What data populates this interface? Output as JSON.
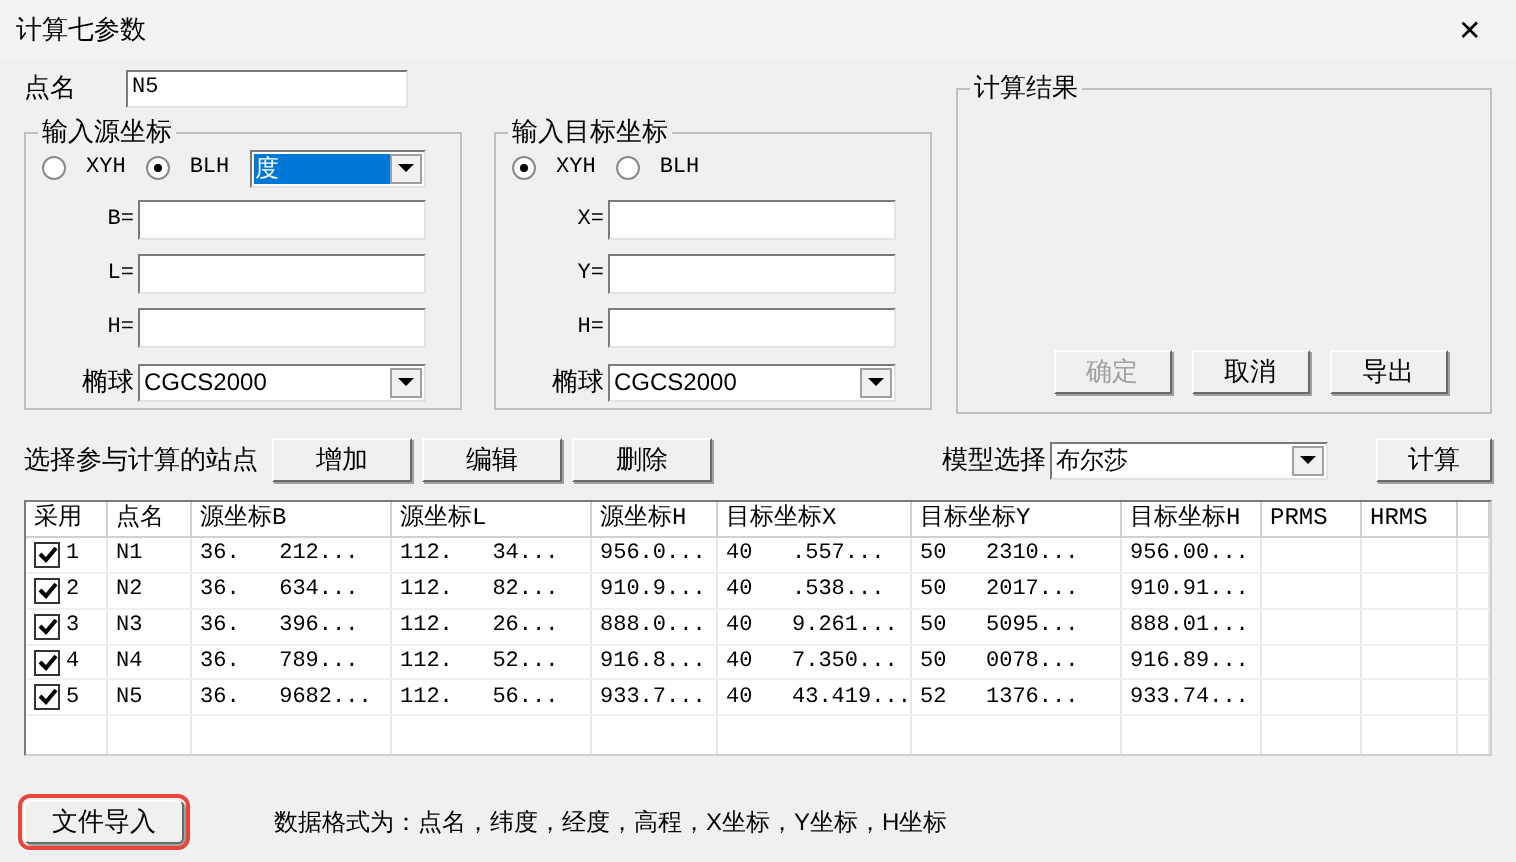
{
  "window": {
    "title": "计算七参数",
    "close": "✕"
  },
  "point_name": {
    "label": "点名",
    "value": "N5"
  },
  "source": {
    "title": "输入源坐标",
    "radios": [
      {
        "label": "XYH",
        "selected": false
      },
      {
        "label": "BLH",
        "selected": true
      }
    ],
    "unit": {
      "value": "度"
    },
    "fields": [
      {
        "label": "B="
      },
      {
        "label": "L="
      },
      {
        "label": "H="
      }
    ],
    "ellipsoid": {
      "label": "椭球",
      "value": "CGCS2000"
    }
  },
  "target": {
    "title": "输入目标坐标",
    "radios": [
      {
        "label": "XYH",
        "selected": true
      },
      {
        "label": "BLH",
        "selected": false
      }
    ],
    "fields": [
      {
        "label": "X="
      },
      {
        "label": "Y="
      },
      {
        "label": "H="
      }
    ],
    "ellipsoid": {
      "label": "椭球",
      "value": "CGCS2000"
    }
  },
  "result": {
    "title": "计算结果",
    "buttons": [
      {
        "label": "确定",
        "disabled": true
      },
      {
        "label": "取消",
        "disabled": false
      },
      {
        "label": "导出",
        "disabled": false
      }
    ]
  },
  "station_bar": {
    "label": "选择参与计算的站点",
    "buttons": [
      "增加",
      "编辑",
      "删除"
    ],
    "model": {
      "label": "模型选择",
      "value": "布尔莎"
    },
    "compute": "计算"
  },
  "table": {
    "columns": [
      "采用",
      "点名",
      "源坐标B",
      "源坐标L",
      "源坐标H",
      "目标坐标X",
      "目标坐标Y",
      "目标坐标H",
      "PRMS",
      "HRMS"
    ],
    "rows": [
      {
        "checked": true,
        "cells": [
          "1",
          "N1",
          "36.   212...",
          "112.   34...",
          "956.0...",
          "40   .557...",
          "50   2310...",
          "956.00..."
        ]
      },
      {
        "checked": true,
        "cells": [
          "2",
          "N2",
          "36.   634...",
          "112.   82...",
          "910.9...",
          "40   .538...",
          "50   2017...",
          "910.91..."
        ]
      },
      {
        "checked": true,
        "cells": [
          "3",
          "N3",
          "36.   396...",
          "112.   26...",
          "888.0...",
          "40   9.261...",
          "50   5095...",
          "888.01..."
        ]
      },
      {
        "checked": true,
        "cells": [
          "4",
          "N4",
          "36.   789...",
          "112.   52...",
          "916.8...",
          "40   7.350...",
          "50   0078...",
          "916.89..."
        ]
      },
      {
        "checked": true,
        "cells": [
          "5",
          "N5",
          "36.   9682...",
          "112.   56...",
          "933.7...",
          "40   43.419...",
          "52   1376...",
          "933.74..."
        ]
      }
    ]
  },
  "footer": {
    "import_button": {
      "label": "文件导入",
      "highlighted": true
    },
    "note": "数据格式为：点名，纬度，经度，高程，X坐标，Y坐标，H坐标"
  }
}
